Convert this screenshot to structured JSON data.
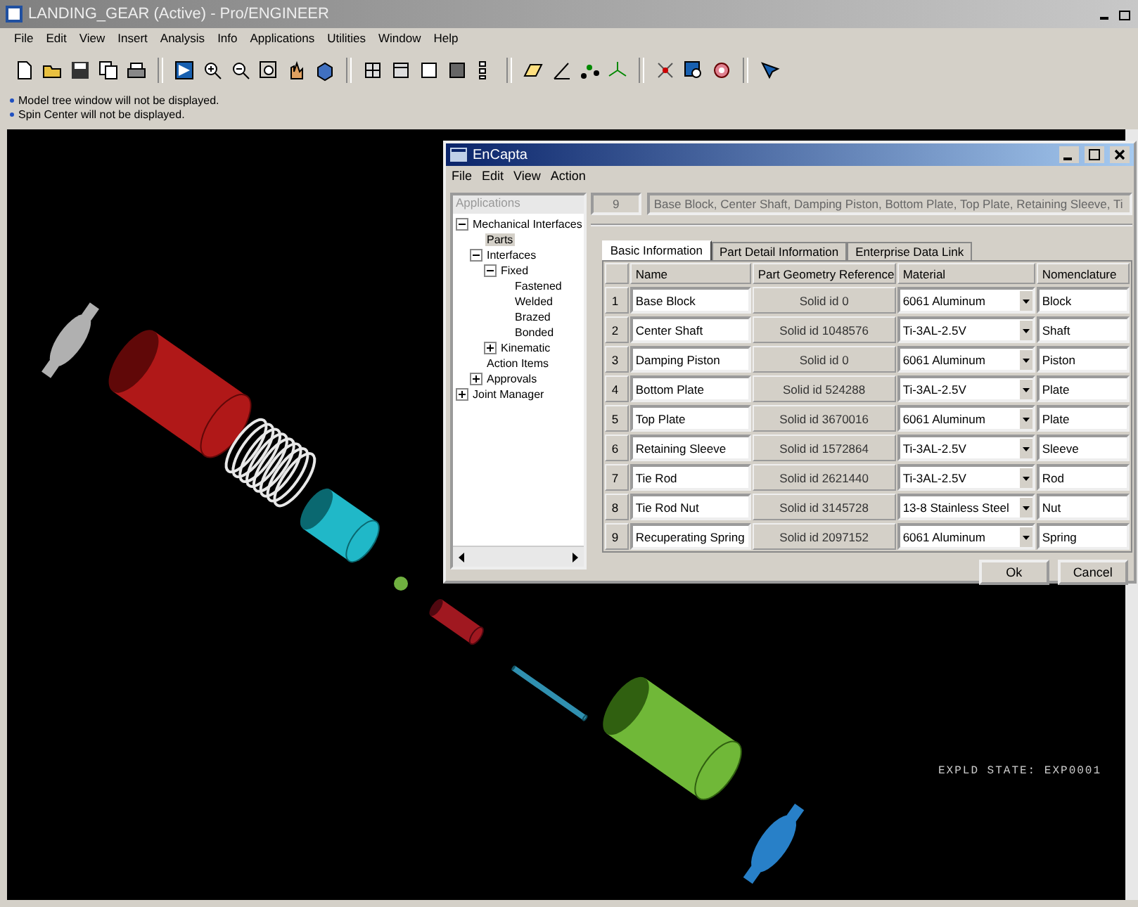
{
  "window": {
    "title": "LANDING_GEAR (Active) - Pro/ENGINEER"
  },
  "menu": [
    "File",
    "Edit",
    "View",
    "Insert",
    "Analysis",
    "Info",
    "Applications",
    "Utilities",
    "Window",
    "Help"
  ],
  "messages": [
    "Model tree window will not be displayed.",
    "Spin Center will not be displayed."
  ],
  "viewport": {
    "state_label": "EXPLD STATE: EXP0001"
  },
  "dialog": {
    "title": "EnCapta",
    "menu": [
      "File",
      "Edit",
      "View",
      "Action"
    ],
    "tree": {
      "header": "Applications",
      "items": [
        {
          "label": "Mechanical Interfaces",
          "expanded": true,
          "selected": false,
          "children": [
            {
              "label": "Parts",
              "selected": true
            },
            {
              "label": "Interfaces",
              "expanded": true,
              "selected": false,
              "children": [
                {
                  "label": "Fixed",
                  "expanded": true,
                  "selected": false,
                  "children": [
                    {
                      "label": "Fastened",
                      "selected": false
                    },
                    {
                      "label": "Welded",
                      "selected": false
                    },
                    {
                      "label": "Brazed",
                      "selected": false
                    },
                    {
                      "label": "Bonded",
                      "selected": false
                    }
                  ]
                },
                {
                  "label": "Kinematic",
                  "expanded": false,
                  "selected": false
                }
              ]
            },
            {
              "label": "Action Items",
              "selected": false
            },
            {
              "label": "Approvals",
              "expanded": false,
              "selected": false
            }
          ]
        },
        {
          "label": "Joint Manager",
          "expanded": false,
          "selected": false
        }
      ]
    },
    "count": "9",
    "parts_list": "Base Block, Center Shaft, Damping Piston, Bottom Plate, Top Plate, Retaining Sleeve, Ti",
    "tabs": [
      {
        "label": "Basic Information",
        "selected": true
      },
      {
        "label": "Part Detail Information",
        "selected": false
      },
      {
        "label": "Enterprise Data Link",
        "selected": false
      }
    ],
    "table": {
      "columns": [
        "Name",
        "Part Geometry Reference",
        "Material",
        "Nomenclature"
      ],
      "rows": [
        {
          "index": "1",
          "name": "Base Block",
          "geometry": "Solid id 0",
          "material": "6061 Aluminum",
          "nomenclature": "Block"
        },
        {
          "index": "2",
          "name": "Center Shaft",
          "geometry": "Solid id 1048576",
          "material": "Ti-3AL-2.5V",
          "nomenclature": "Shaft"
        },
        {
          "index": "3",
          "name": "Damping Piston",
          "geometry": "Solid id 0",
          "material": "6061 Aluminum",
          "nomenclature": "Piston"
        },
        {
          "index": "4",
          "name": "Bottom Plate",
          "geometry": "Solid id 524288",
          "material": "Ti-3AL-2.5V",
          "nomenclature": "Plate"
        },
        {
          "index": "5",
          "name": "Top Plate",
          "geometry": "Solid id 3670016",
          "material": "6061 Aluminum",
          "nomenclature": "Plate"
        },
        {
          "index": "6",
          "name": "Retaining Sleeve",
          "geometry": "Solid id 1572864",
          "material": "Ti-3AL-2.5V",
          "nomenclature": "Sleeve"
        },
        {
          "index": "7",
          "name": "Tie Rod",
          "geometry": "Solid id 2621440",
          "material": "Ti-3AL-2.5V",
          "nomenclature": "Rod"
        },
        {
          "index": "8",
          "name": "Tie Rod Nut",
          "geometry": "Solid id 3145728",
          "material": "13-8 Stainless Steel",
          "nomenclature": "Nut"
        },
        {
          "index": "9",
          "name": "Recuperating Spring",
          "geometry": "Solid id 2097152",
          "material": "6061 Aluminum",
          "nomenclature": "Spring"
        }
      ]
    },
    "buttons": [
      "Ok",
      "Cancel"
    ]
  }
}
